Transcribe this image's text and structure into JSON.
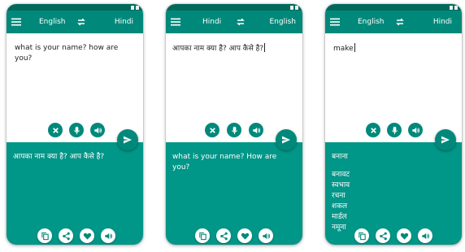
{
  "colors": {
    "primary": "#00897b",
    "primary_dark": "#00695c",
    "output_bg": "#009688"
  },
  "screens": [
    {
      "source_lang": "English",
      "target_lang": "Hindi",
      "input_text": "what is your name? how are you?",
      "output_text": "आपका नाम क्या है? आप कैसे है?",
      "meanings": []
    },
    {
      "source_lang": "Hindi",
      "target_lang": "English",
      "input_text": "आपका नाम क्या है? आप कैसे है?",
      "output_text": "what is your name? How are you?",
      "meanings": []
    },
    {
      "source_lang": "English",
      "target_lang": "Hindi",
      "input_text": "make",
      "output_text": "बनाना",
      "meanings": [
        "बनावट",
        "स्वभाव",
        "रचना",
        "शकल",
        "मार्डल",
        "नमूना"
      ]
    }
  ],
  "icons": {
    "menu": "menu-icon",
    "swap": "swap-icon",
    "clear": "close-icon",
    "mic": "mic-icon",
    "speak": "speaker-icon",
    "send": "send-icon",
    "copy": "copy-icon",
    "share": "share-icon",
    "favorite": "heart-icon"
  }
}
